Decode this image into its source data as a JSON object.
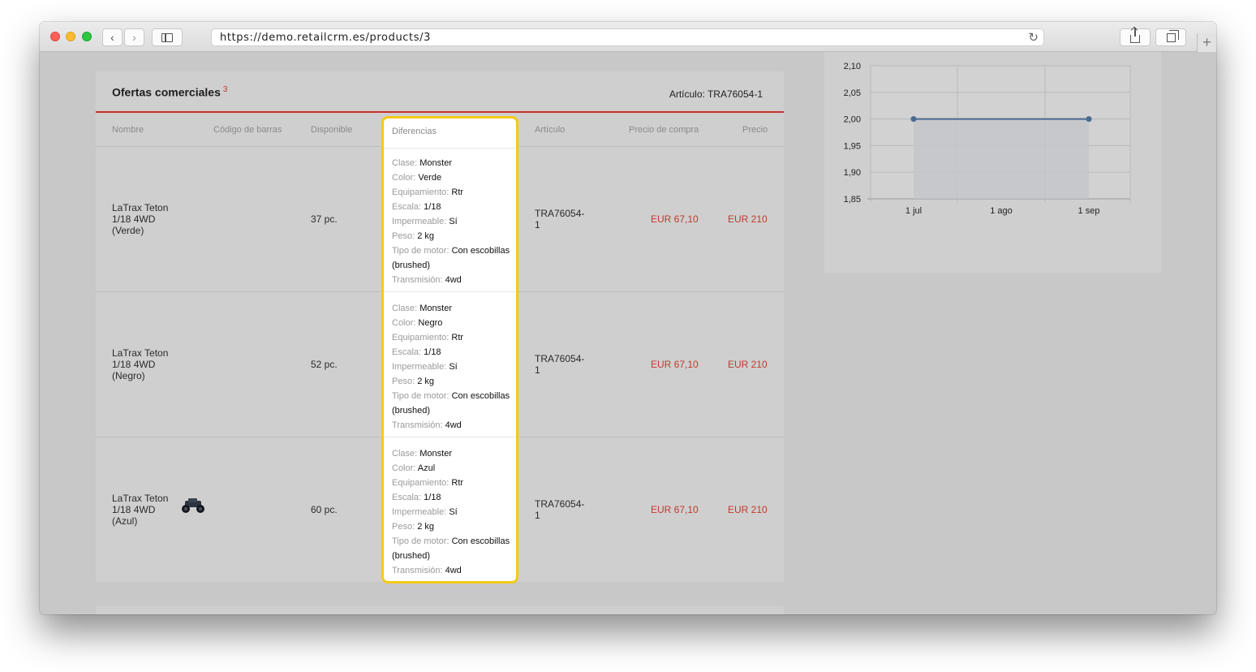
{
  "browser": {
    "url": "https://demo.retailcrm.es/products/3"
  },
  "offers": {
    "title": "Ofertas comerciales",
    "count": "3",
    "article_label": "Artículo: TRA76054-1",
    "columns": [
      "Nombre",
      "Código de barras",
      "Disponible",
      "Diferencias",
      "Artículo",
      "Precio de compra",
      "Precio"
    ],
    "rows": [
      {
        "name_lines": [
          "LaTrax Teton",
          "1/18 4WD",
          "(Verde)"
        ],
        "available": "37 pc.",
        "article_lines": [
          "TRA76054-",
          "1"
        ],
        "purchase_price": "EUR 67,10",
        "price": "EUR 210",
        "has_image": false,
        "diffs": [
          {
            "k": "Clase:",
            "v": "Monster"
          },
          {
            "k": "Color:",
            "v": "Verde"
          },
          {
            "k": "Equipamiento:",
            "v": "Rtr"
          },
          {
            "k": "Escala:",
            "v": "1/18"
          },
          {
            "k": "Impermeable:",
            "v": "Sí"
          },
          {
            "k": "Peso:",
            "v": "2 kg"
          },
          {
            "k": "Tipo de motor:",
            "v": "Con escobillas"
          },
          {
            "k": "",
            "v": "(brushed)"
          },
          {
            "k": "Transmisión:",
            "v": "4wd"
          }
        ]
      },
      {
        "name_lines": [
          "LaTrax Teton",
          "1/18 4WD",
          "(Negro)"
        ],
        "available": "52 pc.",
        "article_lines": [
          "TRA76054-",
          "1"
        ],
        "purchase_price": "EUR 67,10",
        "price": "EUR 210",
        "has_image": false,
        "diffs": [
          {
            "k": "Clase:",
            "v": "Monster"
          },
          {
            "k": "Color:",
            "v": "Negro"
          },
          {
            "k": "Equipamiento:",
            "v": "Rtr"
          },
          {
            "k": "Escala:",
            "v": "1/18"
          },
          {
            "k": "Impermeable:",
            "v": "Sí"
          },
          {
            "k": "Peso:",
            "v": "2 kg"
          },
          {
            "k": "Tipo de motor:",
            "v": "Con escobillas"
          },
          {
            "k": "",
            "v": "(brushed)"
          },
          {
            "k": "Transmisión:",
            "v": "4wd"
          }
        ]
      },
      {
        "name_lines": [
          "LaTrax Teton",
          "1/18 4WD",
          "(Azul)"
        ],
        "available": "60 pc.",
        "article_lines": [
          "TRA76054-",
          "1"
        ],
        "purchase_price": "EUR 67,10",
        "price": "EUR 210",
        "has_image": true,
        "diffs": [
          {
            "k": "Clase:",
            "v": "Monster"
          },
          {
            "k": "Color:",
            "v": "Azul"
          },
          {
            "k": "Equipamiento:",
            "v": "Rtr"
          },
          {
            "k": "Escala:",
            "v": "1/18"
          },
          {
            "k": "Impermeable:",
            "v": "Sí"
          },
          {
            "k": "Peso:",
            "v": "2 kg"
          },
          {
            "k": "Tipo de motor:",
            "v": "Con escobillas"
          },
          {
            "k": "",
            "v": "(brushed)"
          },
          {
            "k": "Transmisión:",
            "v": "4wd"
          }
        ]
      }
    ]
  },
  "chart_data": {
    "type": "line",
    "x": [
      "1 jul",
      "1 sep"
    ],
    "categories": [
      "1 jul",
      "1 ago",
      "1 sep"
    ],
    "series": [
      {
        "values": [
          2.0,
          2.0
        ]
      }
    ],
    "y_ticks": [
      "2,10",
      "2,05",
      "2,00",
      "1,95",
      "1,90",
      "1,85"
    ],
    "ylim": [
      1.85,
      2.1
    ],
    "grid": true,
    "colors": {
      "line": "#4a6a8e",
      "area": "#c3c5ca",
      "grid": "#b9b9b9"
    }
  }
}
